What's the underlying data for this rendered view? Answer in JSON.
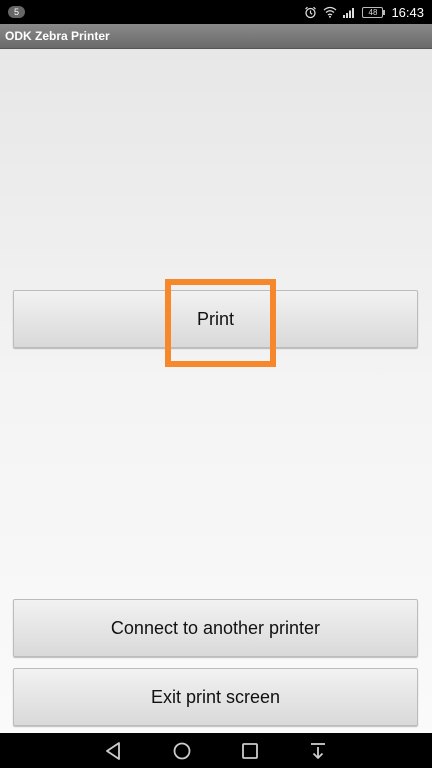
{
  "status_bar": {
    "notification_count": "5",
    "battery_level": "48",
    "time": "16:43",
    "icons": [
      "alarm-icon",
      "wifi-icon",
      "signal-icon",
      "battery-icon"
    ]
  },
  "app": {
    "title": "ODK Zebra Printer"
  },
  "buttons": {
    "print": "Print",
    "connect": "Connect to another printer",
    "exit": "Exit print screen"
  },
  "highlight": {
    "color": "#f7872b",
    "target": "print-button"
  },
  "nav_bar": {
    "icons": [
      "back-icon",
      "home-icon",
      "recents-icon",
      "notifications-pull-icon"
    ]
  }
}
